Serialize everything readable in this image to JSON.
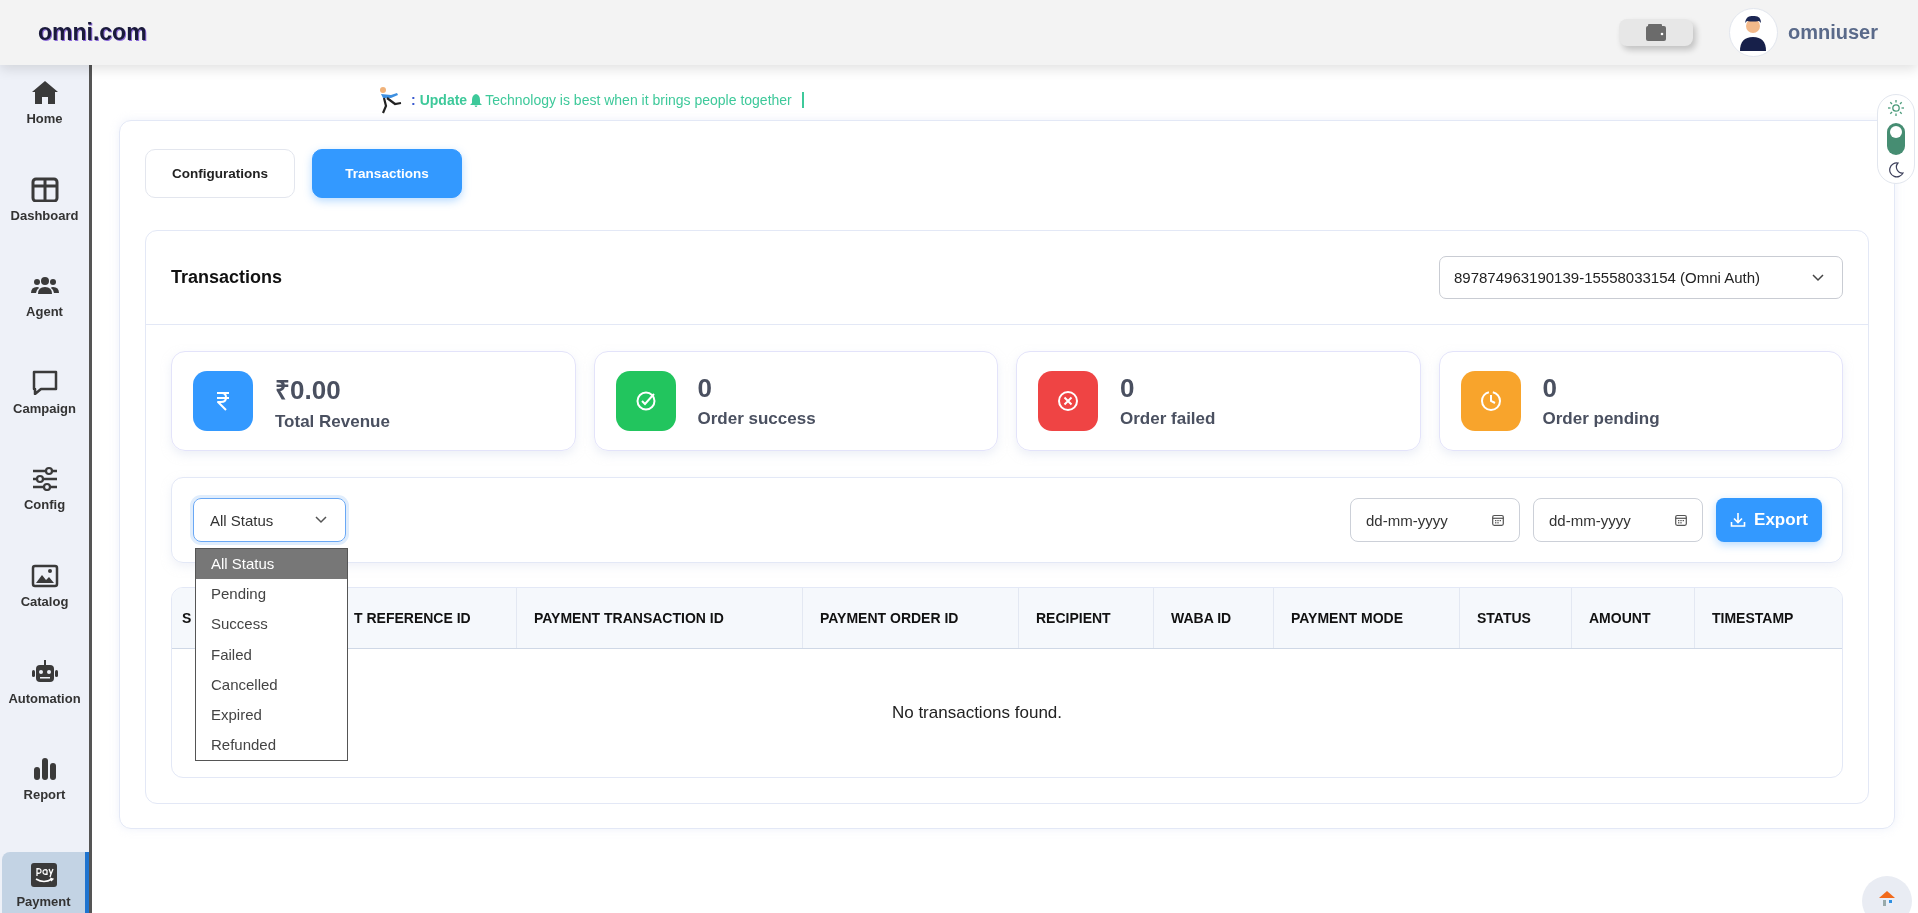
{
  "topbar": {
    "logo": "omni.com",
    "username": "omniuser"
  },
  "sidebar": {
    "items": [
      {
        "label": "Home",
        "selected": false
      },
      {
        "label": "Dashboard",
        "selected": false
      },
      {
        "label": "Agent",
        "selected": false
      },
      {
        "label": "Campaign",
        "selected": false
      },
      {
        "label": "Config",
        "selected": false
      },
      {
        "label": "Catalog",
        "selected": false
      },
      {
        "label": "Automation",
        "selected": false
      },
      {
        "label": "Report",
        "selected": false
      },
      {
        "label": "Payment",
        "selected": true
      }
    ]
  },
  "ticker": {
    "prefix": ":",
    "label": "Update",
    "message": "Technology is best when it brings people together"
  },
  "theme_toggle": {
    "dark_mode": false
  },
  "tabs": [
    {
      "label": "Configurations",
      "selected": false
    },
    {
      "label": "Transactions",
      "selected": true
    }
  ],
  "panel": {
    "title": "Transactions",
    "account_select": "897874963190139-15558033154 (Omni Auth)"
  },
  "stats": [
    {
      "kind": "revenue",
      "value": "₹0.00",
      "label": "Total Revenue",
      "color": "#3399ff"
    },
    {
      "kind": "success",
      "value": "0",
      "label": "Order success",
      "color": "#22c55e"
    },
    {
      "kind": "failed",
      "value": "0",
      "label": "Order failed",
      "color": "#ef4444"
    },
    {
      "kind": "pending",
      "value": "0",
      "label": "Order pending",
      "color": "#f8a42c"
    }
  ],
  "filters": {
    "status_select": {
      "value": "All Status",
      "expanded": true,
      "options": [
        {
          "label": "All Status",
          "selected": true
        },
        {
          "label": "Pending",
          "selected": false
        },
        {
          "label": "Success",
          "selected": false
        },
        {
          "label": "Failed",
          "selected": false
        },
        {
          "label": "Cancelled",
          "selected": false
        },
        {
          "label": "Expired",
          "selected": false
        },
        {
          "label": "Refunded",
          "selected": false
        }
      ]
    },
    "date_from": {
      "placeholder": "dd-mm-yyyy"
    },
    "date_to": {
      "placeholder": "dd-mm-yyyy"
    },
    "export_button": "Export"
  },
  "table": {
    "columns": [
      "S",
      "T REFERENCE ID",
      "PAYMENT TRANSACTION ID",
      "PAYMENT ORDER ID",
      "RECIPIENT",
      "WABA ID",
      "PAYMENT MODE",
      "STATUS",
      "AMOUNT",
      "TIMESTAMP"
    ],
    "empty_message": "No transactions found."
  }
}
